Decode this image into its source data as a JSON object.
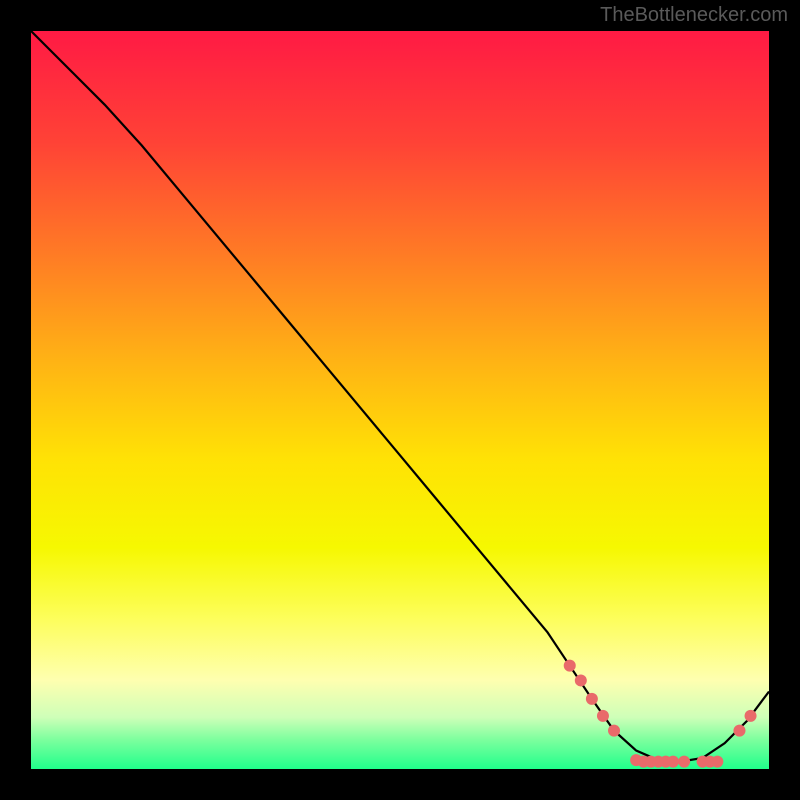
{
  "watermark": "TheBottlenecker.com",
  "chart_data": {
    "type": "line",
    "title": "",
    "xlabel": "",
    "ylabel": "",
    "xlim": [
      0,
      100
    ],
    "ylim": [
      0,
      100
    ],
    "background": {
      "type": "vertical-gradient",
      "stops": [
        {
          "offset": 0.0,
          "color": "#ff1a44"
        },
        {
          "offset": 0.15,
          "color": "#ff4236"
        },
        {
          "offset": 0.3,
          "color": "#ff7a25"
        },
        {
          "offset": 0.45,
          "color": "#ffb414"
        },
        {
          "offset": 0.58,
          "color": "#ffe205"
        },
        {
          "offset": 0.7,
          "color": "#f6f801"
        },
        {
          "offset": 0.8,
          "color": "#fdfe5f"
        },
        {
          "offset": 0.88,
          "color": "#feffb0"
        },
        {
          "offset": 0.93,
          "color": "#ceffb8"
        },
        {
          "offset": 0.96,
          "color": "#7dff9e"
        },
        {
          "offset": 1.0,
          "color": "#20ff8b"
        }
      ]
    },
    "series": [
      {
        "name": "curve",
        "color": "#000000",
        "x": [
          0,
          3,
          6,
          10,
          15,
          20,
          25,
          30,
          35,
          40,
          45,
          50,
          55,
          60,
          65,
          70,
          73,
          76,
          79,
          82,
          85,
          88,
          91,
          94,
          97,
          100
        ],
        "y": [
          100,
          97,
          94,
          90,
          84.5,
          78.5,
          72.5,
          66.5,
          60.5,
          54.5,
          48.5,
          42.5,
          36.5,
          30.5,
          24.5,
          18.5,
          14,
          9.5,
          5.2,
          2.5,
          1.2,
          1.0,
          1.5,
          3.5,
          6.5,
          10.5
        ]
      }
    ],
    "markers": {
      "name": "highlight-dots",
      "color": "#e96a6a",
      "radius": 6,
      "points": [
        {
          "x": 73,
          "y": 14
        },
        {
          "x": 74.5,
          "y": 12
        },
        {
          "x": 76,
          "y": 9.5
        },
        {
          "x": 77.5,
          "y": 7.2
        },
        {
          "x": 79,
          "y": 5.2
        },
        {
          "x": 82,
          "y": 1.2
        },
        {
          "x": 83,
          "y": 1.0
        },
        {
          "x": 84,
          "y": 1.0
        },
        {
          "x": 85,
          "y": 1.0
        },
        {
          "x": 86,
          "y": 1.0
        },
        {
          "x": 87,
          "y": 1.0
        },
        {
          "x": 88.5,
          "y": 1.0
        },
        {
          "x": 91,
          "y": 1.0
        },
        {
          "x": 92,
          "y": 1.0
        },
        {
          "x": 93,
          "y": 1.0
        },
        {
          "x": 96,
          "y": 5.2
        },
        {
          "x": 97.5,
          "y": 7.2
        }
      ]
    }
  }
}
